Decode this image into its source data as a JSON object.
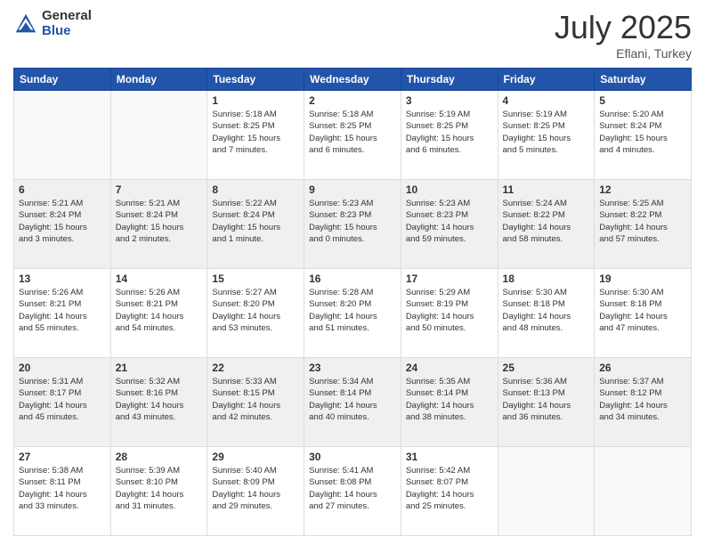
{
  "header": {
    "logo_general": "General",
    "logo_blue": "Blue",
    "title": "July 2025",
    "location": "Eflani, Turkey"
  },
  "weekdays": [
    "Sunday",
    "Monday",
    "Tuesday",
    "Wednesday",
    "Thursday",
    "Friday",
    "Saturday"
  ],
  "weeks": [
    [
      {
        "day": "",
        "info": ""
      },
      {
        "day": "",
        "info": ""
      },
      {
        "day": "1",
        "info": "Sunrise: 5:18 AM\nSunset: 8:25 PM\nDaylight: 15 hours\nand 7 minutes."
      },
      {
        "day": "2",
        "info": "Sunrise: 5:18 AM\nSunset: 8:25 PM\nDaylight: 15 hours\nand 6 minutes."
      },
      {
        "day": "3",
        "info": "Sunrise: 5:19 AM\nSunset: 8:25 PM\nDaylight: 15 hours\nand 6 minutes."
      },
      {
        "day": "4",
        "info": "Sunrise: 5:19 AM\nSunset: 8:25 PM\nDaylight: 15 hours\nand 5 minutes."
      },
      {
        "day": "5",
        "info": "Sunrise: 5:20 AM\nSunset: 8:24 PM\nDaylight: 15 hours\nand 4 minutes."
      }
    ],
    [
      {
        "day": "6",
        "info": "Sunrise: 5:21 AM\nSunset: 8:24 PM\nDaylight: 15 hours\nand 3 minutes."
      },
      {
        "day": "7",
        "info": "Sunrise: 5:21 AM\nSunset: 8:24 PM\nDaylight: 15 hours\nand 2 minutes."
      },
      {
        "day": "8",
        "info": "Sunrise: 5:22 AM\nSunset: 8:24 PM\nDaylight: 15 hours\nand 1 minute."
      },
      {
        "day": "9",
        "info": "Sunrise: 5:23 AM\nSunset: 8:23 PM\nDaylight: 15 hours\nand 0 minutes."
      },
      {
        "day": "10",
        "info": "Sunrise: 5:23 AM\nSunset: 8:23 PM\nDaylight: 14 hours\nand 59 minutes."
      },
      {
        "day": "11",
        "info": "Sunrise: 5:24 AM\nSunset: 8:22 PM\nDaylight: 14 hours\nand 58 minutes."
      },
      {
        "day": "12",
        "info": "Sunrise: 5:25 AM\nSunset: 8:22 PM\nDaylight: 14 hours\nand 57 minutes."
      }
    ],
    [
      {
        "day": "13",
        "info": "Sunrise: 5:26 AM\nSunset: 8:21 PM\nDaylight: 14 hours\nand 55 minutes."
      },
      {
        "day": "14",
        "info": "Sunrise: 5:26 AM\nSunset: 8:21 PM\nDaylight: 14 hours\nand 54 minutes."
      },
      {
        "day": "15",
        "info": "Sunrise: 5:27 AM\nSunset: 8:20 PM\nDaylight: 14 hours\nand 53 minutes."
      },
      {
        "day": "16",
        "info": "Sunrise: 5:28 AM\nSunset: 8:20 PM\nDaylight: 14 hours\nand 51 minutes."
      },
      {
        "day": "17",
        "info": "Sunrise: 5:29 AM\nSunset: 8:19 PM\nDaylight: 14 hours\nand 50 minutes."
      },
      {
        "day": "18",
        "info": "Sunrise: 5:30 AM\nSunset: 8:18 PM\nDaylight: 14 hours\nand 48 minutes."
      },
      {
        "day": "19",
        "info": "Sunrise: 5:30 AM\nSunset: 8:18 PM\nDaylight: 14 hours\nand 47 minutes."
      }
    ],
    [
      {
        "day": "20",
        "info": "Sunrise: 5:31 AM\nSunset: 8:17 PM\nDaylight: 14 hours\nand 45 minutes."
      },
      {
        "day": "21",
        "info": "Sunrise: 5:32 AM\nSunset: 8:16 PM\nDaylight: 14 hours\nand 43 minutes."
      },
      {
        "day": "22",
        "info": "Sunrise: 5:33 AM\nSunset: 8:15 PM\nDaylight: 14 hours\nand 42 minutes."
      },
      {
        "day": "23",
        "info": "Sunrise: 5:34 AM\nSunset: 8:14 PM\nDaylight: 14 hours\nand 40 minutes."
      },
      {
        "day": "24",
        "info": "Sunrise: 5:35 AM\nSunset: 8:14 PM\nDaylight: 14 hours\nand 38 minutes."
      },
      {
        "day": "25",
        "info": "Sunrise: 5:36 AM\nSunset: 8:13 PM\nDaylight: 14 hours\nand 36 minutes."
      },
      {
        "day": "26",
        "info": "Sunrise: 5:37 AM\nSunset: 8:12 PM\nDaylight: 14 hours\nand 34 minutes."
      }
    ],
    [
      {
        "day": "27",
        "info": "Sunrise: 5:38 AM\nSunset: 8:11 PM\nDaylight: 14 hours\nand 33 minutes."
      },
      {
        "day": "28",
        "info": "Sunrise: 5:39 AM\nSunset: 8:10 PM\nDaylight: 14 hours\nand 31 minutes."
      },
      {
        "day": "29",
        "info": "Sunrise: 5:40 AM\nSunset: 8:09 PM\nDaylight: 14 hours\nand 29 minutes."
      },
      {
        "day": "30",
        "info": "Sunrise: 5:41 AM\nSunset: 8:08 PM\nDaylight: 14 hours\nand 27 minutes."
      },
      {
        "day": "31",
        "info": "Sunrise: 5:42 AM\nSunset: 8:07 PM\nDaylight: 14 hours\nand 25 minutes."
      },
      {
        "day": "",
        "info": ""
      },
      {
        "day": "",
        "info": ""
      }
    ]
  ]
}
